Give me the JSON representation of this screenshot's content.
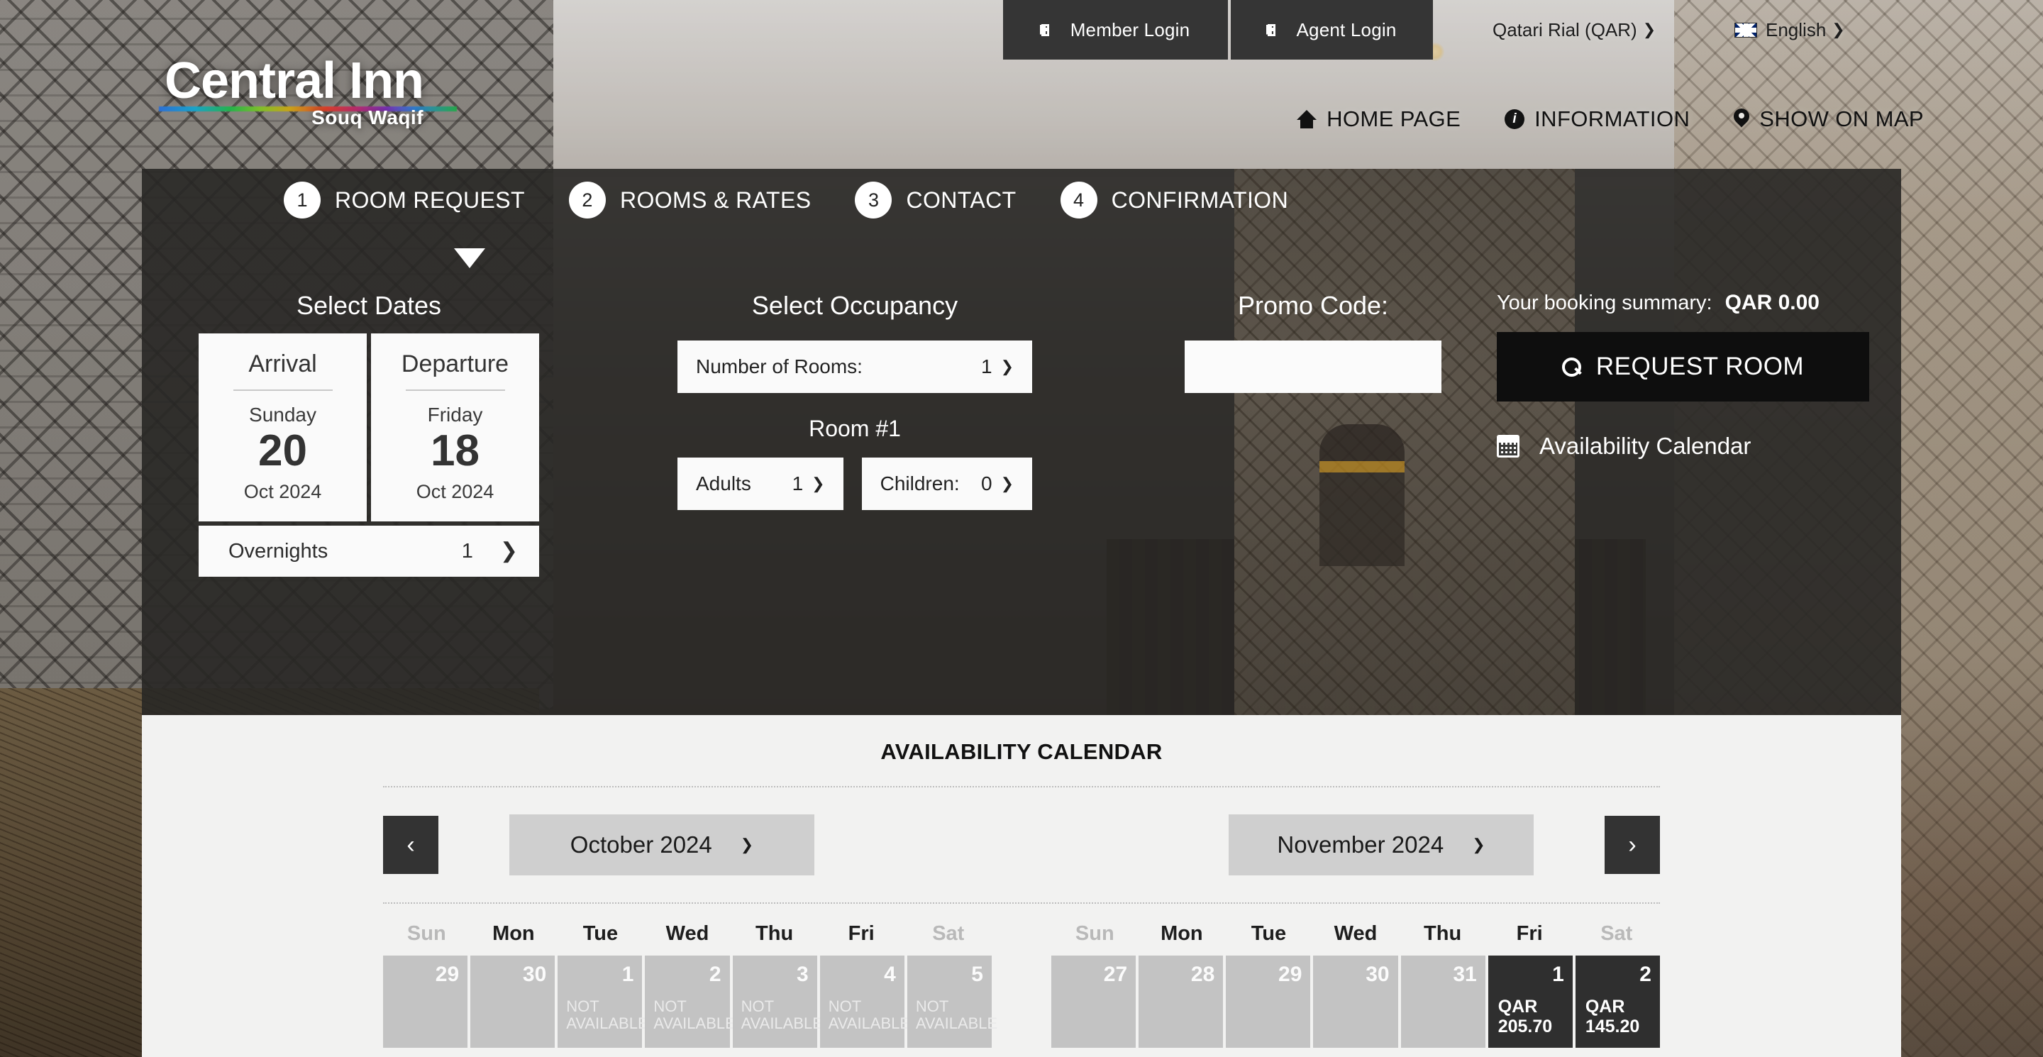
{
  "topbar": {
    "member_login": "Member Login",
    "agent_login": "Agent Login",
    "currency": "Qatari Rial (QAR)",
    "language": "English",
    "caret": "⌄"
  },
  "logo": {
    "main": "Central Inn",
    "sub": "Souq Waqif"
  },
  "mainnav": [
    {
      "label": "HOME PAGE",
      "icon": "home-icon"
    },
    {
      "label": "INFORMATION",
      "icon": "info-icon"
    },
    {
      "label": "SHOW ON MAP",
      "icon": "map-pin-icon"
    }
  ],
  "steps": [
    {
      "num": "1",
      "label": "ROOM REQUEST"
    },
    {
      "num": "2",
      "label": "ROOMS & RATES"
    },
    {
      "num": "3",
      "label": "CONTACT"
    },
    {
      "num": "4",
      "label": "CONFIRMATION"
    }
  ],
  "dates": {
    "heading": "Select Dates",
    "arrival": {
      "title": "Arrival",
      "dow": "Sunday",
      "day": "20",
      "monthyear": "Oct 2024"
    },
    "departure": {
      "title": "Departure",
      "dow": "Friday",
      "day": "18",
      "monthyear": "Oct 2024"
    },
    "overnights_label": "Overnights",
    "overnights_value": "1"
  },
  "occupancy": {
    "heading": "Select Occupancy",
    "rooms_label": "Number of Rooms:",
    "rooms_value": "1",
    "room_header": "Room #1",
    "adults_label": "Adults",
    "adults_value": "1",
    "children_label": "Children:",
    "children_value": "0"
  },
  "promo": {
    "heading": "Promo Code:",
    "value": "",
    "placeholder": ""
  },
  "summary": {
    "label": "Your booking summary:",
    "amount": "QAR 0.00",
    "request_button": "REQUEST ROOM",
    "availability_link": "Availability Calendar"
  },
  "calendar": {
    "title": "AVAILABILITY CALENDAR",
    "prev": "‹",
    "next": "›",
    "left_month": "October 2024",
    "right_month": "November 2024",
    "dow": [
      "Sun",
      "Mon",
      "Tue",
      "Wed",
      "Thu",
      "Fri",
      "Sat"
    ],
    "not_available": "NOT AVAILABLE",
    "left_cells": [
      {
        "num": "29",
        "state": "muted",
        "status": ""
      },
      {
        "num": "30",
        "state": "muted",
        "status": ""
      },
      {
        "num": "1",
        "state": "unavailable",
        "status": "NOT AVAILABLE"
      },
      {
        "num": "2",
        "state": "unavailable",
        "status": "NOT AVAILABLE"
      },
      {
        "num": "3",
        "state": "unavailable",
        "status": "NOT AVAILABLE"
      },
      {
        "num": "4",
        "state": "unavailable",
        "status": "NOT AVAILABLE"
      },
      {
        "num": "5",
        "state": "unavailable",
        "status": "NOT AVAILABLE"
      }
    ],
    "right_cells": [
      {
        "num": "27",
        "state": "muted",
        "status": ""
      },
      {
        "num": "28",
        "state": "muted",
        "status": ""
      },
      {
        "num": "29",
        "state": "muted",
        "status": ""
      },
      {
        "num": "30",
        "state": "muted",
        "status": ""
      },
      {
        "num": "31",
        "state": "muted",
        "status": ""
      },
      {
        "num": "1",
        "state": "priced",
        "currency": "QAR",
        "price": "205.70"
      },
      {
        "num": "2",
        "state": "priced",
        "currency": "QAR",
        "price": "145.20"
      }
    ]
  },
  "colors": {
    "panel": "#282725",
    "dark_button": "#0e0e0e",
    "cell_muted": "#c3c3c3",
    "cell_priced": "#2f2f2f",
    "calendar_bg": "#f2f2f1"
  }
}
